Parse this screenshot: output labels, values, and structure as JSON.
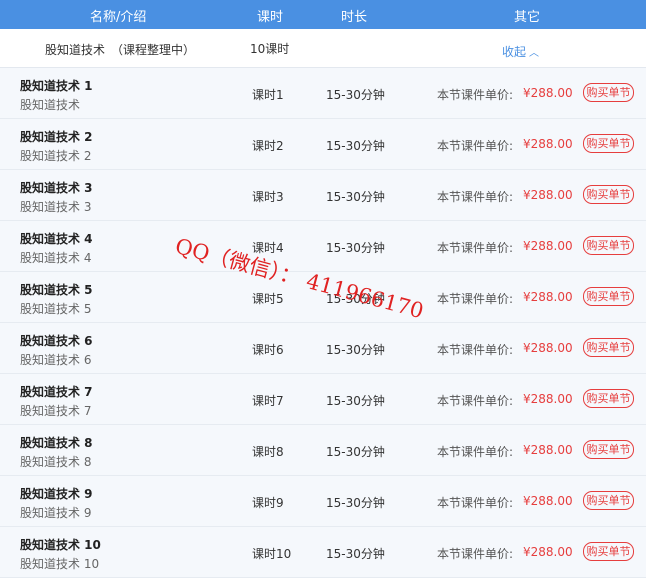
{
  "header": {
    "col_name": "名称/介绍",
    "col_hours": "课时",
    "col_duration": "时长",
    "col_other": "其它"
  },
  "summary": {
    "name": "股知道技术　（课程整理中）",
    "hours": "10课时",
    "collapse_label": "收起"
  },
  "rows": [
    {
      "title": "股知道技术 1",
      "sub": "股知道技术",
      "lesson": "课时1",
      "duration": "15-30分钟",
      "price_label": "本节课件单价:",
      "price": "¥288.00",
      "buy": "购买单节"
    },
    {
      "title": "股知道技术 2",
      "sub": "股知道技术 2",
      "lesson": "课时2",
      "duration": "15-30分钟",
      "price_label": "本节课件单价:",
      "price": "¥288.00",
      "buy": "购买单节"
    },
    {
      "title": "股知道技术 3",
      "sub": "股知道技术 3",
      "lesson": "课时3",
      "duration": "15-30分钟",
      "price_label": "本节课件单价:",
      "price": "¥288.00",
      "buy": "购买单节"
    },
    {
      "title": "股知道技术 4",
      "sub": "股知道技术 4",
      "lesson": "课时4",
      "duration": "15-30分钟",
      "price_label": "本节课件单价:",
      "price": "¥288.00",
      "buy": "购买单节"
    },
    {
      "title": "股知道技术 5",
      "sub": "股知道技术 5",
      "lesson": "课时5",
      "duration": "15-30分钟",
      "price_label": "本节课件单价:",
      "price": "¥288.00",
      "buy": "购买单节"
    },
    {
      "title": "股知道技术 6",
      "sub": "股知道技术 6",
      "lesson": "课时6",
      "duration": "15-30分钟",
      "price_label": "本节课件单价:",
      "price": "¥288.00",
      "buy": "购买单节"
    },
    {
      "title": "股知道技术 7",
      "sub": "股知道技术 7",
      "lesson": "课时7",
      "duration": "15-30分钟",
      "price_label": "本节课件单价:",
      "price": "¥288.00",
      "buy": "购买单节"
    },
    {
      "title": "股知道技术 8",
      "sub": "股知道技术 8",
      "lesson": "课时8",
      "duration": "15-30分钟",
      "price_label": "本节课件单价:",
      "price": "¥288.00",
      "buy": "购买单节"
    },
    {
      "title": "股知道技术 9",
      "sub": "股知道技术 9",
      "lesson": "课时9",
      "duration": "15-30分钟",
      "price_label": "本节课件单价:",
      "price": "¥288.00",
      "buy": "购买单节"
    },
    {
      "title": "股知道技术 10",
      "sub": "股知道技术 10",
      "lesson": "课时10",
      "duration": "15-30分钟",
      "price_label": "本节课件单价:",
      "price": "¥288.00",
      "buy": "购买单节"
    }
  ],
  "watermark": "QQ（微信）： 411966170",
  "colors": {
    "header_bg": "#4a90e2",
    "row_bg": "#f5f8fc",
    "price": "#e63e3e",
    "link": "#4a90e2"
  },
  "icons": {
    "collapse": "chevron-up-icon"
  }
}
